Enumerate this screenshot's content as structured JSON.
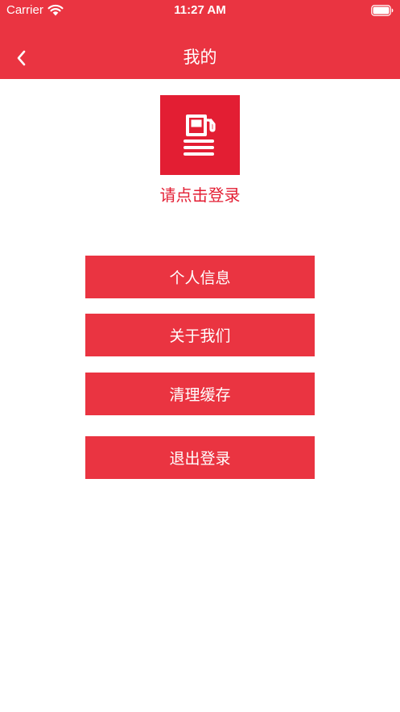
{
  "status_bar": {
    "carrier": "Carrier",
    "time": "11:27 AM"
  },
  "nav": {
    "title": "我的",
    "back_icon": "chevron-left-icon"
  },
  "profile": {
    "logo_icon": "gas-station-icon",
    "login_prompt": "请点击登录"
  },
  "menu": {
    "personal_info": "个人信息",
    "about_us": "关于我们",
    "clear_cache": "清理缓存",
    "logout": "退出登录"
  },
  "colors": {
    "brand_red": "#EA3441",
    "logo_red": "#E31E33",
    "background": "#FFFFFF",
    "text_on_brand": "#FFFFFF"
  }
}
